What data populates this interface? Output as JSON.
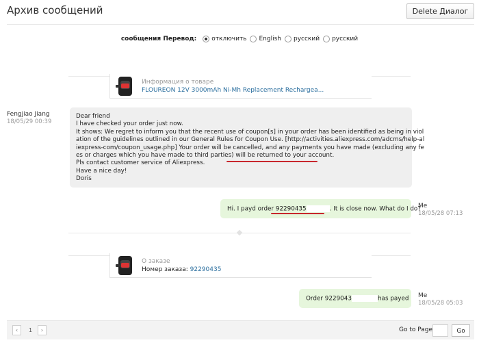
{
  "header": {
    "title": "Архив сообщений",
    "delete_button": "Delete Диалог"
  },
  "translation": {
    "label": "сообщения Перевод:",
    "options": [
      "отключить",
      "English",
      "русский",
      "русский"
    ],
    "selected": "отключить"
  },
  "product_card": {
    "label": "Информация о товаре",
    "name": "FLOUREON 12V 3000mAh Ni-Mh Replacement Rechargea..."
  },
  "messages": [
    {
      "sender": "Fengjiao Jiang",
      "time": "18/05/29 00:39",
      "lines": [
        "Dear friend",
        "I have checked your order just now.",
        "It shows:  We regret to inform you that the recent use of coupon[s] in your order has been identified as being in viol",
        "ation of the guidelines outlined in our General Rules for Coupon Use. [http://activities.aliexpress.com/adcms/help-al",
        "iexpress-com/coupon_usage.php] Your order will be cancelled, and any payments you have made (excluding any fe",
        "es or charges which you have made to third parties)",
        "will be returned to your account.",
        "Pls contact customer service of Aliexpress.",
        "Have a nice day!",
        "Doris"
      ]
    },
    {
      "sender": "Me",
      "time": "18/05/28 07:13",
      "text_before": "Hi. I payd order 92290435",
      "text_after": ". It is close now. What do I do?"
    },
    {
      "sender": "Me",
      "time": "18/05/28 05:03",
      "text_before": "Order 9229043",
      "text_after": "has payed"
    }
  ],
  "order_card": {
    "label": "О заказе",
    "number_label": "Номер заказа:",
    "number": "92290435"
  },
  "pager": {
    "prev": "‹",
    "page": "1",
    "next": "›",
    "goto_label": "Go to Page",
    "go_button": "Go"
  },
  "colors": {
    "gray_bubble": "#efefef",
    "green_bubble": "#e6f6dc",
    "link": "#2a6e9e",
    "annotation_red": "#c8272d"
  }
}
